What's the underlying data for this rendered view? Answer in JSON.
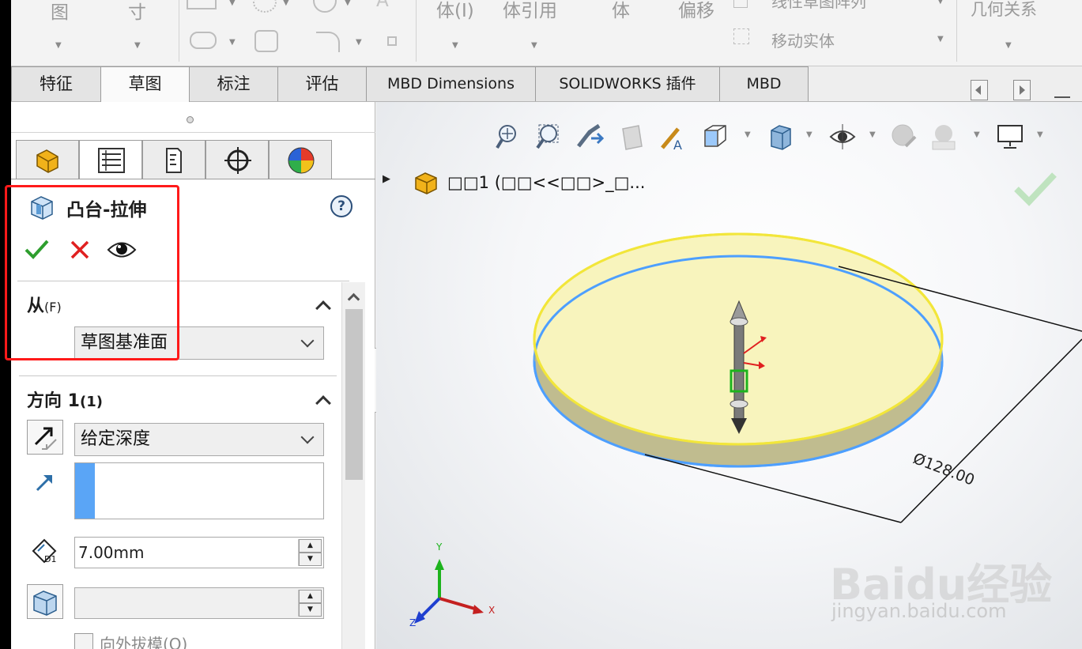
{
  "ribbon": {
    "left_group": [
      "图",
      "寸"
    ],
    "body_group": [
      "体(I)",
      "体引用",
      "体",
      "偏移"
    ],
    "pattern_label": "线性草图阵列",
    "move_label": "移动实体",
    "relations_label": "几何关系"
  },
  "tabs": [
    "特征",
    "草图",
    "标注",
    "评估",
    "MBD Dimensions",
    "SOLIDWORKS 插件",
    "MBD"
  ],
  "active_tab": "草图",
  "property_manager": {
    "title": "凸台-拉伸",
    "help": "?",
    "from_section": {
      "label": "从",
      "hotkey": "(F)",
      "selected": "草图基准面"
    },
    "direction1_section": {
      "label": "方向 1",
      "hotkey": "(1)",
      "end_condition": "给定深度",
      "depth_value": "7.00mm",
      "depth_icon_text": "D1",
      "draft_checkbox_label": "向外拔模(O)"
    }
  },
  "viewport": {
    "tree_label": "□□1  (□□<<□□>_□...",
    "dimension_text": "Ø128.00",
    "axis_labels": {
      "x": "X",
      "y": "Y",
      "z": "Z"
    },
    "watermark_brand": "Baidu经验",
    "watermark_url": "jingyan.baidu.com"
  },
  "colors": {
    "accent_blue": "#4d9fff",
    "confirm_green": "#2e9e2e",
    "cancel_red": "#e02020",
    "highlight_red": "#ff1a1a",
    "part_yellow": "#f5f0b0"
  }
}
